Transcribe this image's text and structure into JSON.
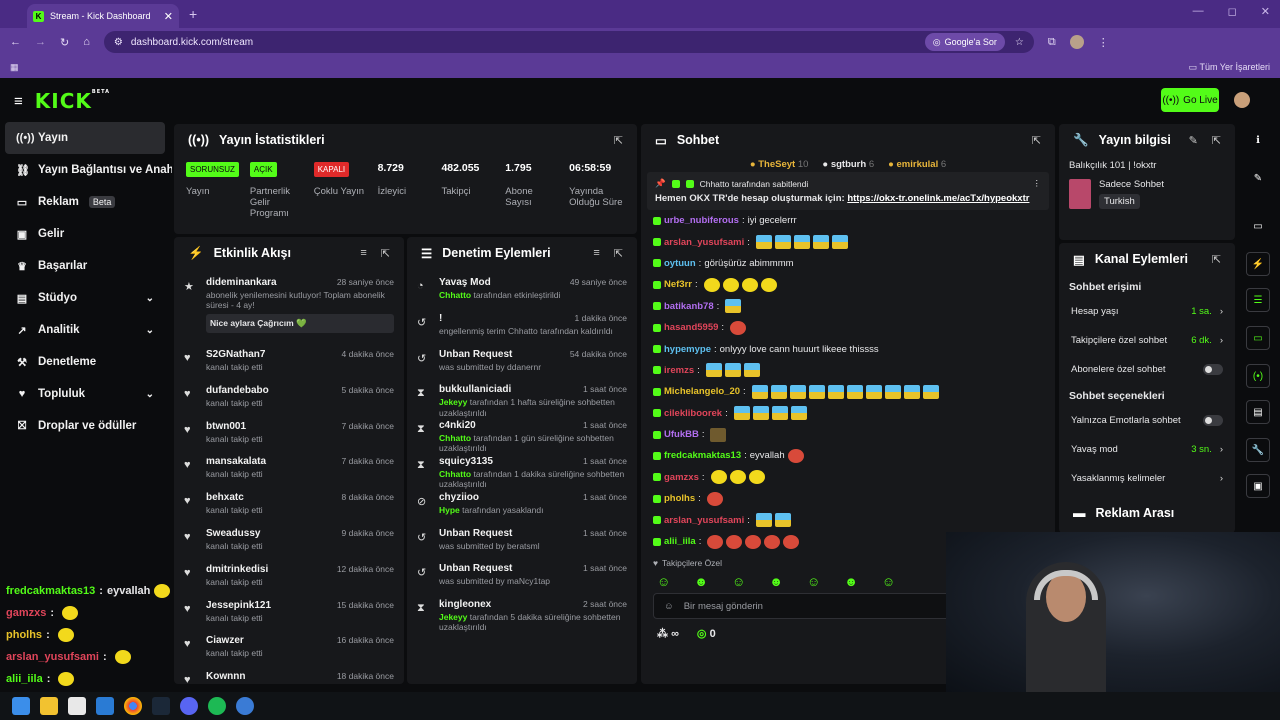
{
  "browser": {
    "tab_title": "Stream - Kick Dashboard",
    "tab_close": "✕",
    "new_tab": "+",
    "url": "dashboard.kick.com/stream",
    "google_btn": "Google'a Sor",
    "bookmarks_label": "Tüm Yer İşaretleri",
    "window_controls": [
      "—",
      "◻",
      "✕"
    ]
  },
  "header": {
    "logo": "KICK",
    "logo_badge": "BETA",
    "go_live": "Go Live"
  },
  "sidebar": {
    "items": [
      {
        "label": "Yayın",
        "icon": "broadcast-icon",
        "chev": ""
      },
      {
        "label": "Yayın Bağlantısı ve Anahtarı",
        "icon": "link-icon",
        "chev": ""
      },
      {
        "label": "Reklam",
        "icon": "ad-icon",
        "chev": "",
        "badge": "Beta"
      },
      {
        "label": "Gelir",
        "icon": "wallet-icon",
        "chev": ""
      },
      {
        "label": "Başarılar",
        "icon": "trophy-icon",
        "chev": ""
      },
      {
        "label": "Stüdyo",
        "icon": "studio-icon",
        "chev": "⌄"
      },
      {
        "label": "Analitik",
        "icon": "chart-icon",
        "chev": "⌄"
      },
      {
        "label": "Denetleme",
        "icon": "hammer-icon",
        "chev": ""
      },
      {
        "label": "Topluluk",
        "icon": "community-icon",
        "chev": "⌄"
      },
      {
        "label": "Droplar ve ödüller",
        "icon": "gift-icon",
        "chev": ""
      }
    ]
  },
  "stats_panel": {
    "title": "Yayın İstatistikleri",
    "stats": [
      {
        "value": "SORUNSUZ",
        "label": "Yayın",
        "kind": "green"
      },
      {
        "value": "AÇIK",
        "label": "Partnerlik Gelir Programı",
        "kind": "green"
      },
      {
        "value": "KAPALI",
        "label": "Çoklu Yayın",
        "kind": "red"
      },
      {
        "value": "8.729",
        "label": "İzleyici",
        "kind": "num"
      },
      {
        "value": "482.055",
        "label": "Takipçi",
        "kind": "num"
      },
      {
        "value": "1.795",
        "label": "Abone Sayısı",
        "kind": "num"
      },
      {
        "value": "06:58:59",
        "label": "Yayında Olduğu Süre",
        "kind": "num"
      }
    ]
  },
  "activity": {
    "title": "Etkinlik Akışı",
    "first": {
      "name": "dideminankara",
      "time": "28 saniye önce",
      "text": "abonelik yenilemesini kutluyor! Toplam abonelik süresi - 4 ay!",
      "highlight": "Nice aylara Çağrıcım 💚"
    },
    "items": [
      {
        "name": "S2GNathan7",
        "time": "4 dakika önce",
        "text": "kanalı takip etti"
      },
      {
        "name": "dufandebabo",
        "time": "5 dakika önce",
        "text": "kanalı takip etti"
      },
      {
        "name": "btwn001",
        "time": "7 dakika önce",
        "text": "kanalı takip etti"
      },
      {
        "name": "mansakalata",
        "time": "7 dakika önce",
        "text": "kanalı takip etti"
      },
      {
        "name": "behxatc",
        "time": "8 dakika önce",
        "text": "kanalı takip etti"
      },
      {
        "name": "Sweadussy",
        "time": "9 dakika önce",
        "text": "kanalı takip etti"
      },
      {
        "name": "dmitrinkedisi",
        "time": "12 dakika önce",
        "text": "kanalı takip etti"
      },
      {
        "name": "Jessepink121",
        "time": "15 dakika önce",
        "text": "kanalı takip etti"
      },
      {
        "name": "Ciawzer",
        "time": "16 dakika önce",
        "text": "kanalı takip etti"
      },
      {
        "name": "Kownnn",
        "time": "18 dakika önce",
        "text": ""
      }
    ]
  },
  "moderation": {
    "title": "Denetim Eylemleri",
    "items": [
      {
        "icon": "slow-icon",
        "glyph": "◔",
        "name": "Yavaş Mod",
        "time": "49 saniye önce",
        "actor": "Chhatto",
        "text": " tarafından etkinleştirildi"
      },
      {
        "icon": "undo-icon",
        "glyph": "↺",
        "name": "!",
        "time": "1 dakika önce",
        "actor": "",
        "text": "engellenmiş terim Chhatto tarafından kaldırıldı"
      },
      {
        "icon": "undo-icon",
        "glyph": "↺",
        "name": "Unban Request",
        "time": "54 dakika önce",
        "actor": "",
        "text": "was submitted by ddanernr"
      },
      {
        "icon": "hourglass-icon",
        "glyph": "⧗",
        "name": "bukkullaniciadi",
        "time": "1 saat önce",
        "actor": "Jekeyy",
        "text": " tarafından 1 hafta süreliğine sohbetten uzaklaştırıldı"
      },
      {
        "icon": "hourglass-icon",
        "glyph": "⧗",
        "name": "c4nki20",
        "time": "1 saat önce",
        "actor": "Chhatto",
        "text": " tarafından 1 gün süreliğine sohbetten uzaklaştırıldı"
      },
      {
        "icon": "hourglass-icon",
        "glyph": "⧗",
        "name": "squicy3135",
        "time": "1 saat önce",
        "actor": "Chhatto",
        "text": " tarafından 1 dakika süreliğine sohbetten uzaklaştırıldı"
      },
      {
        "icon": "ban-icon",
        "glyph": "⊘",
        "name": "chyziioo",
        "time": "1 saat önce",
        "actor": "Hype",
        "text": " tarafından yasaklandı"
      },
      {
        "icon": "undo-icon",
        "glyph": "↺",
        "name": "Unban Request",
        "time": "1 saat önce",
        "actor": "",
        "text": "was submitted by beratsml"
      },
      {
        "icon": "undo-icon",
        "glyph": "↺",
        "name": "Unban Request",
        "time": "1 saat önce",
        "actor": "",
        "text": "was submitted by maNcy1tap"
      },
      {
        "icon": "hourglass-icon",
        "glyph": "⧗",
        "name": "kingleonex",
        "time": "2 saat önce",
        "actor": "Jekeyy",
        "text": " tarafından 5 dakika süreliğine sohbetten uzaklaştırıldı"
      }
    ]
  },
  "chat": {
    "title": "Sohbet",
    "top_gifters": [
      {
        "name": "TheSeyt",
        "count": "10",
        "color": "#e8b53a"
      },
      {
        "name": "sgtburh",
        "count": "6",
        "color": "#e8e8ea"
      },
      {
        "name": "emirkulal",
        "count": "6",
        "color": "#e8b53a"
      }
    ],
    "pinned_by": "Chhatto tarafından sabitlendi",
    "pinned_text": "Hemen OKX TR'de hesap oluşturmak için: ",
    "pinned_link": "https://okx-tr.onelink.me/acTx/hypeokxtr",
    "messages": [
      {
        "user": "urbe_nubiferous",
        "color": "#b26ef0",
        "text": "iyi gecelerrr",
        "emotes": 0,
        "etype": ""
      },
      {
        "user": "arslan_yusufsami",
        "color": "#e0455a",
        "text": "",
        "emotes": 5,
        "etype": "k"
      },
      {
        "user": "oytuun",
        "color": "#5ec0f0",
        "text": "görüşürüz abimmmm",
        "emotes": 0,
        "etype": ""
      },
      {
        "user": "Nef3rr",
        "color": "#e8c32a",
        "text": "",
        "emotes": 4,
        "etype": "h"
      },
      {
        "user": "batikanb78",
        "color": "#b26ef0",
        "text": "",
        "emotes": 1,
        "etype": "k"
      },
      {
        "user": "hasand5959",
        "color": "#e0455a",
        "text": "",
        "emotes": 1,
        "etype": "f"
      },
      {
        "user": "hypemype",
        "color": "#5ec0f0",
        "text": "onlyyy love cann huuurt likeee thissss",
        "emotes": 0,
        "etype": ""
      },
      {
        "user": "iremzs",
        "color": "#e0455a",
        "text": "",
        "emotes": 3,
        "etype": "k"
      },
      {
        "user": "Michelangelo_20",
        "color": "#e8c32a",
        "text": "",
        "emotes": 10,
        "etype": "k"
      },
      {
        "user": "cilekliboorek",
        "color": "#e0455a",
        "text": "",
        "emotes": 4,
        "etype": "k"
      },
      {
        "user": "UfukBB",
        "color": "#b26ef0",
        "text": "",
        "emotes": 1,
        "etype": ""
      },
      {
        "user": "fredcakmaktas13",
        "color": "#53fc18",
        "text": "eyvallah",
        "emotes": 1,
        "etype": "f"
      },
      {
        "user": "gamzxs",
        "color": "#e0455a",
        "text": "",
        "emotes": 3,
        "etype": "h"
      },
      {
        "user": "pholhs",
        "color": "#e8c32a",
        "text": "",
        "emotes": 1,
        "etype": "f"
      },
      {
        "user": "arslan_yusufsami",
        "color": "#e0455a",
        "text": "",
        "emotes": 2,
        "etype": "k"
      },
      {
        "user": "alii_iila",
        "color": "#53fc18",
        "text": "",
        "emotes": 5,
        "etype": "f"
      }
    ],
    "followers_only": "Takipçilere Özel",
    "placeholder": "Bir mesaj gönderin",
    "infinity": "∞",
    "points": "0"
  },
  "stream_info": {
    "title": "Yayın bilgisi",
    "stream_title": "Balıkçılık 101 | !okxtr",
    "category": "Sadece Sohbet",
    "language": "Turkish"
  },
  "channel_actions": {
    "title": "Kanal Eylemleri",
    "access_heading": "Sohbet erişimi",
    "options_heading": "Sohbet seçenekleri",
    "access_rows": [
      {
        "label": "Hesap yaşı",
        "value": "1 sa.",
        "kind": "arrow"
      },
      {
        "label": "Takipçilere özel sohbet",
        "value": "6 dk.",
        "kind": "arrow"
      },
      {
        "label": "Abonelere özel sohbet",
        "value": "",
        "kind": "toggle"
      }
    ],
    "option_rows": [
      {
        "label": "Yalnızca Emotlarla sohbet",
        "value": "",
        "kind": "toggle"
      },
      {
        "label": "Yavaş mod",
        "value": "3 sn.",
        "kind": "arrow"
      },
      {
        "label": "Yasaklanmış kelimeler",
        "value": "",
        "kind": "arrow"
      }
    ],
    "next_section": "Reklam Arası"
  },
  "overlay_chat": [
    {
      "user": "fredcakmaktas13",
      "color": "#53fc18",
      "text": "eyvallah"
    },
    {
      "user": "gamzxs",
      "color": "#e0455a",
      "text": ""
    },
    {
      "user": "pholhs",
      "color": "#e8c32a",
      "text": ""
    },
    {
      "user": "arslan_yusufsami",
      "color": "#e0455a",
      "text": ""
    },
    {
      "user": "alii_iila",
      "color": "#53fc18",
      "text": ""
    }
  ]
}
